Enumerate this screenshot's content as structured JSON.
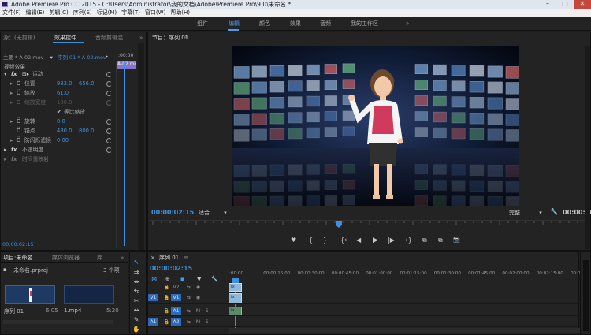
{
  "window": {
    "title": "Adobe Premiere Pro CC 2015 - C:\\Users\\Administrator\\我的文档\\Adobe\\Premiere Pro\\9.0\\未命名 *",
    "controls": [
      "–",
      "□",
      "✕"
    ]
  },
  "menu": [
    "文件(F)",
    "编辑(E)",
    "剪辑(C)",
    "序列(S)",
    "标记(M)",
    "字幕(T)",
    "窗口(W)",
    "帮助(H)"
  ],
  "workspaces": {
    "tabs": [
      "组件",
      "编辑",
      "颜色",
      "效果",
      "音频",
      "我的工作区"
    ],
    "active_index": 1,
    "more": "»"
  },
  "source_panel": {
    "tabs": [
      "源：(无剪辑)",
      "效果控件",
      "音频剪辑混"
    ],
    "active_index": 1,
    "more": "»"
  },
  "effect_controls": {
    "master": "主要 * A-02.mov",
    "sequence": "序列 01 * A-02.mov",
    "mini_time": ":00:00",
    "clip_label": "A-02.mo",
    "section": "视频效果",
    "rows": [
      {
        "kind": "fx",
        "label": "运动"
      },
      {
        "kind": "prop",
        "label": "位置",
        "v1": "983.0",
        "v2": "656.0"
      },
      {
        "kind": "prop",
        "label": "缩放",
        "v1": "61.0",
        "v2": ""
      },
      {
        "kind": "prop-dim",
        "label": "缩放宽度",
        "v1": "100.0",
        "v2": ""
      },
      {
        "kind": "check",
        "label": "等比缩放"
      },
      {
        "kind": "prop",
        "label": "旋转",
        "v1": "0.0",
        "v2": ""
      },
      {
        "kind": "prop",
        "label": "锚点",
        "v1": "480.0",
        "v2": "800.0"
      },
      {
        "kind": "prop",
        "label": "防闪烁滤镜",
        "v1": "0.00",
        "v2": ""
      },
      {
        "kind": "fx",
        "label": "不透明度"
      },
      {
        "kind": "fx-dim",
        "label": "时间重映射"
      }
    ],
    "timecode": "00:00:02:15"
  },
  "program_monitor": {
    "title": "节目：序列 01",
    "menu_icon": "≡",
    "timecode": "00:00:02:15",
    "fit": "适合",
    "quality": "完整",
    "duration": "00:00:06:",
    "transport": [
      "♥",
      "{",
      "}",
      "{←",
      "◀|",
      "▶",
      "|▶",
      "→}",
      "⧉",
      "⧉",
      "📷"
    ]
  },
  "project_panel": {
    "tabs": [
      "项目:未命名",
      "媒体浏览器",
      "库"
    ],
    "active_index": 0,
    "more": "»",
    "file": "未命名.prproj",
    "count": "3 个项",
    "items": [
      {
        "name": "序列 01",
        "duration": "6:05"
      },
      {
        "name": "1.mp4",
        "duration": "5:20"
      }
    ]
  },
  "timeline": {
    "title": "序列 01",
    "close": "×",
    "menu_icon": "≡",
    "timecode": "00:00:02:15",
    "ruler": [
      ":00:00",
      "00:00:15:00",
      "00:00:30:00",
      "00:00:45:00",
      "00:01:00:00",
      "00:01:15:00",
      "00:01:30:00",
      "00:01:45:00",
      "00:02:00:00",
      "00:02:15:00",
      "00:02:30"
    ],
    "tracks": [
      {
        "id": "V2",
        "src": ""
      },
      {
        "id": "V1",
        "src": "V1"
      },
      {
        "id": "A1",
        "src": "A1"
      },
      {
        "id": "A2",
        "src": "A2"
      }
    ],
    "mute": "M",
    "solo": "S"
  },
  "colors": {
    "accent": "#3d8fd8",
    "playhead": "#3c8fe8",
    "clip": "#8fb8d8"
  }
}
